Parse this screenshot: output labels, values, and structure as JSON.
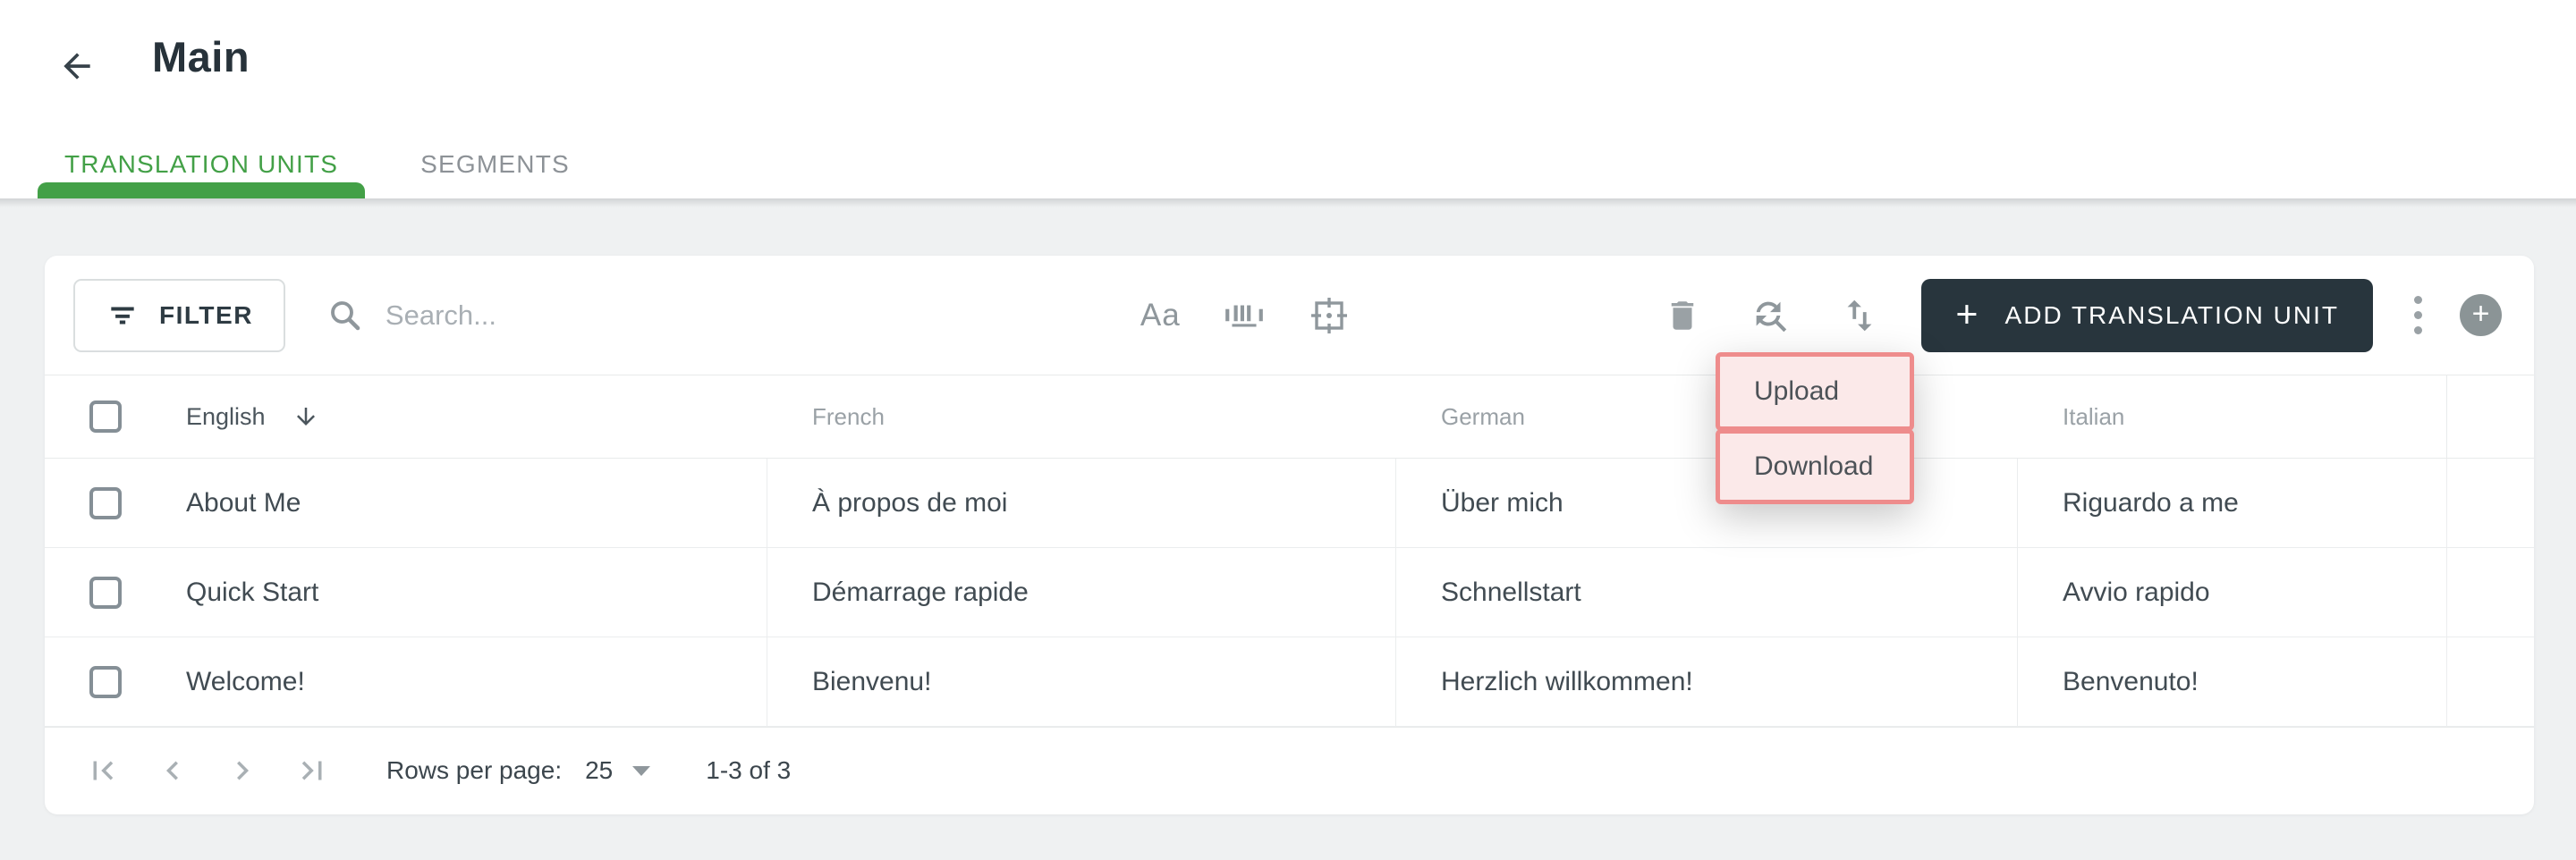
{
  "header": {
    "title": "Main"
  },
  "tabs": [
    {
      "label": "TRANSLATION UNITS",
      "active": true
    },
    {
      "label": "SEGMENTS",
      "active": false
    }
  ],
  "toolbar": {
    "filter_label": "FILTER",
    "search_placeholder": "Search...",
    "add_button_label": "ADD TRANSLATION UNIT",
    "add_button_plus": "+",
    "fab_plus": "+"
  },
  "icons": {
    "back": "arrow-left",
    "filter": "filter-lines",
    "search": "magnifier",
    "case": "Aa",
    "barcode": "barcode",
    "focus": "center-focus-frame",
    "delete": "trash",
    "sync": "find-replace",
    "sort": "import-export",
    "more": "kebab-vertical",
    "sort_desc": "arrow-down",
    "pager": [
      "first-page",
      "chevron-left",
      "chevron-right",
      "last-page"
    ]
  },
  "menu": {
    "items": [
      {
        "label": "Upload"
      },
      {
        "label": "Download"
      }
    ]
  },
  "table": {
    "columns": [
      "English",
      "French",
      "German",
      "Italian"
    ],
    "sort_column": "English",
    "sort_direction": "desc",
    "rows": [
      [
        "About Me",
        "À propos de moi",
        "Über mich",
        "Riguardo a me"
      ],
      [
        "Quick Start",
        "Démarrage rapide",
        "Schnellstart",
        "Avvio rapido"
      ],
      [
        "Welcome!",
        "Bienvenu!",
        "Herzlich willkommen!",
        "Benvenuto!"
      ]
    ]
  },
  "pagination": {
    "rows_per_page_label": "Rows per page:",
    "rows_per_page_value": "25",
    "range_label": "1-3 of 3"
  },
  "colors": {
    "accent_green": "#43a047",
    "add_button_bg": "#28353d",
    "annotation_border": "#ee8c8c",
    "annotation_fill": "#fbe9e9",
    "page_bg": "#eff1f2"
  }
}
